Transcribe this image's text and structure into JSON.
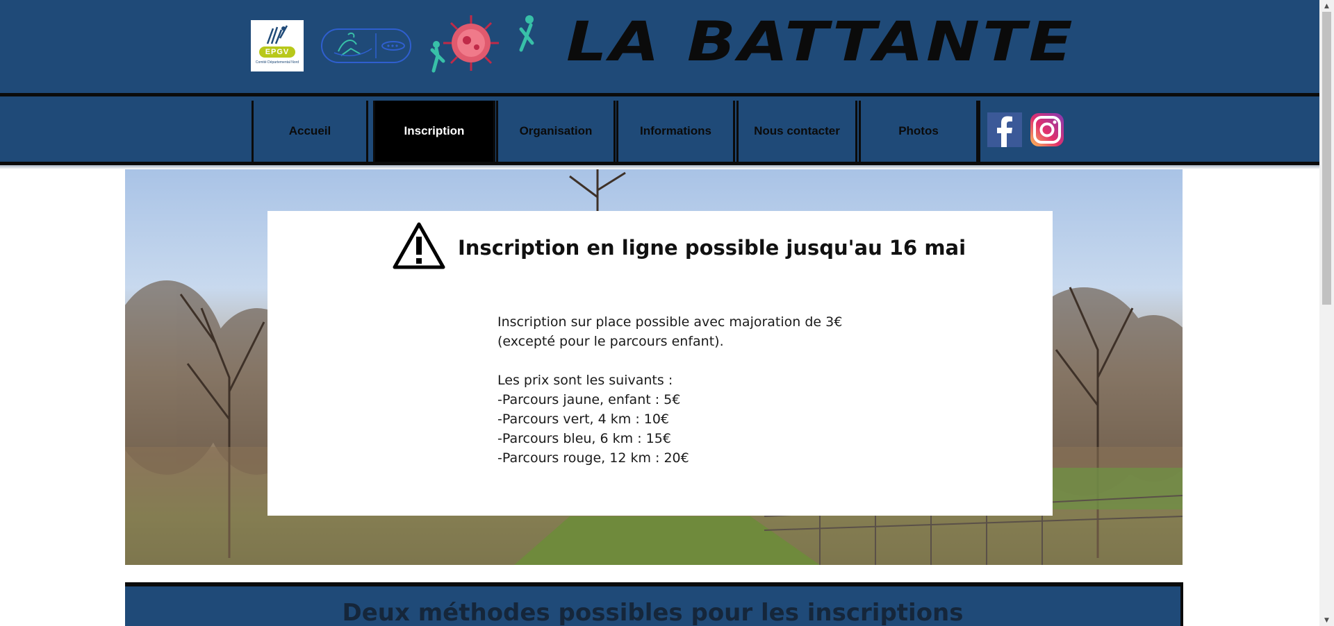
{
  "header": {
    "site_title": "LA BATTANTE",
    "logos": [
      {
        "name": "EPGV",
        "badge_text": "EPGV",
        "subtitle": "Comité Départemental Nord"
      },
      {
        "name": "running-club-logo"
      },
      {
        "name": "virus-runners-logo"
      }
    ]
  },
  "nav": {
    "items": [
      {
        "label": "Accueil",
        "active": false
      },
      {
        "label": "Inscription",
        "active": true
      },
      {
        "label": "Organisation",
        "active": false
      },
      {
        "label": "Informations",
        "active": false
      },
      {
        "label": "Nous contacter",
        "active": false
      },
      {
        "label": "Photos",
        "active": false
      }
    ],
    "social": [
      {
        "icon": "facebook-icon",
        "color": "#3b5998"
      },
      {
        "icon": "instagram-icon",
        "color": "#c13584"
      }
    ]
  },
  "notice": {
    "icon": "warning-icon",
    "title": "Inscription en ligne possible jusqu'au 16 mai",
    "lines": [
      "Inscription sur place possible avec majoration de 3€",
      "(excepté pour le parcours enfant).",
      "",
      "Les prix sont les suivants :",
      "-Parcours jaune, enfant : 5€",
      "-Parcours vert, 4 km : 10€",
      "-Parcours bleu, 6 km : 15€",
      "-Parcours rouge, 12 km : 20€"
    ]
  },
  "section2": {
    "title": "Deux méthodes possibles pour les inscriptions"
  },
  "colors": {
    "brand_blue": "#1f4a78",
    "black": "#0b0b0b",
    "active_nav": "#000000"
  }
}
